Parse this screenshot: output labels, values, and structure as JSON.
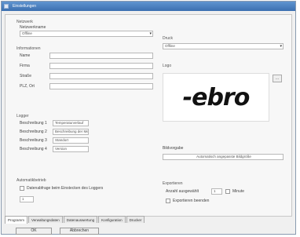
{
  "window": {
    "title": "Einstellungen"
  },
  "left": {
    "network_section": "Netzwerk",
    "network_label": "Netzwerkname",
    "network_value": "Offline",
    "info_section": "Informationen",
    "name_label": "Name",
    "firma_label": "Firma",
    "strasse_label": "Straße",
    "plz_label": "PLZ, Ort",
    "logger_section": "Logger",
    "desc1_label": "Beschreibung 1",
    "desc1_value": "Temperaturverlauf",
    "desc2_label": "Beschreibung 2",
    "desc2_value": "Beschreibung der Messung",
    "desc3_label": "Beschreibung 3",
    "desc3_value": "Standort",
    "desc4_label": "Beschreibung 4",
    "desc4_value": "Version",
    "auto_section": "Automatikbetrieb",
    "auto_check_label": "Datenabfrage beim Einstecken des Loggers",
    "stepper_value": "1"
  },
  "right": {
    "drucker_section": "Druck",
    "drucker_value": "Offline",
    "logo_section": "Logo",
    "logo_text": "-ebro",
    "bild_label": "Bildvorgabe",
    "bild_value": "Automatisch angepasste Bildgröße",
    "export_section": "Exportieren",
    "export_value_label": "Anzahl ausgewählt",
    "export_value": "1",
    "export_unit": "Minute",
    "export_check_label": "Exportieren beenden"
  },
  "tabs": [
    "Programm",
    "Verwaltungsdaten",
    "Datenauswertung",
    "Konfiguration",
    "Drucker"
  ],
  "buttons": {
    "ok": "OK",
    "cancel": "Abbrechen"
  }
}
